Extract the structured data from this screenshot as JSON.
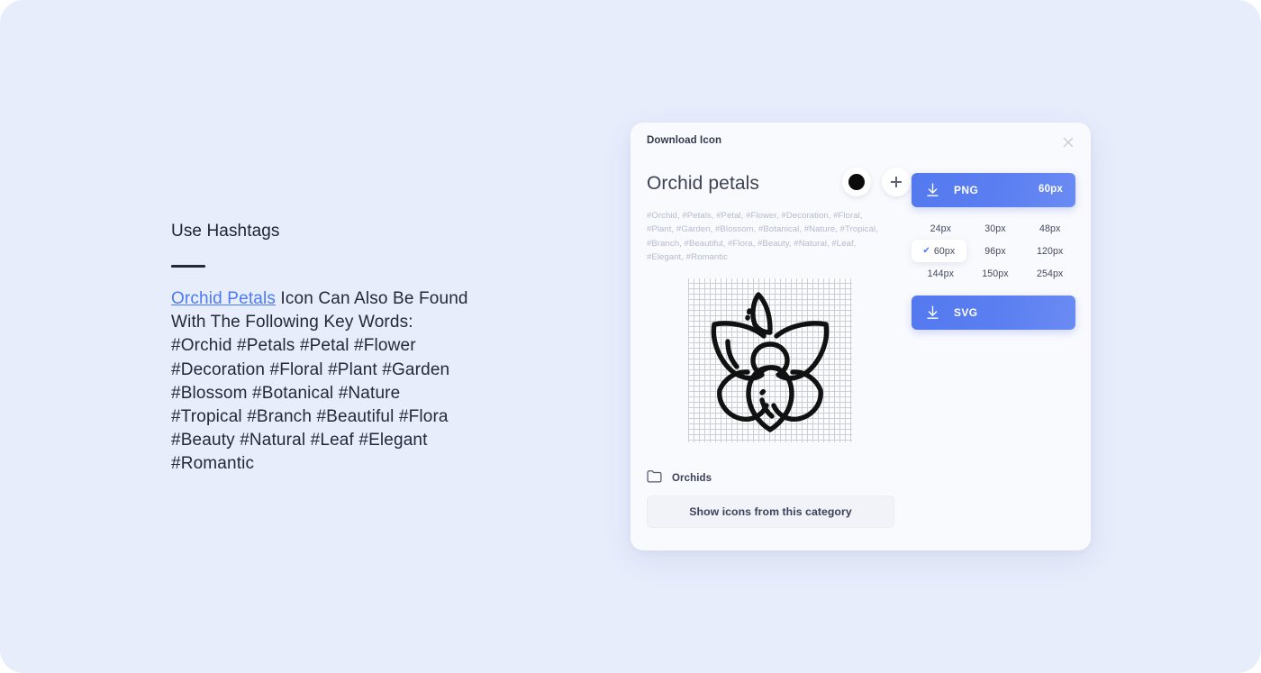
{
  "page": {
    "background_color": "#e8edfc"
  },
  "left_panel": {
    "heading": "Use Hashtags",
    "link_text": "Orchid Petals",
    "body_text": " Icon Can Also Be Found With The Following Key Words: #Orchid #Petals #Petal #Flower #Decoration #Floral #Plant #Garden #Blossom #Botanical #Nature #Tropical #Branch #Beautiful #Flora #Beauty #Natural #Leaf #Elegant #Romantic",
    "link_color": "#4b7bf5"
  },
  "modal": {
    "title": "Download Icon",
    "close_icon": "close-icon",
    "icon_name": "Orchid petals",
    "color_swatch": "#0b0b0b",
    "add_button_icon": "plus-icon",
    "tags": "#Orchid, #Petals, #Petal, #Flower, #Decoration, #Floral, #Plant, #Garden, #Blossom, #Botanical, #Nature, #Tropical, #Branch, #Beautiful, #Flora, #Beauty, #Natural, #Leaf, #Elegant, #Romantic",
    "preview_icon": "orchid-flower-icon",
    "folder": {
      "icon": "folder-icon",
      "label": "Orchids"
    },
    "category_button_label": "Show icons from this category",
    "download": {
      "png": {
        "icon": "download-icon",
        "format_label": "PNG",
        "size_label": "60px",
        "accent_color": "#5b7ff1"
      },
      "svg": {
        "icon": "download-icon",
        "format_label": "SVG",
        "accent_color": "#5b7ff1"
      },
      "sizes": [
        {
          "label": "24px",
          "selected": false
        },
        {
          "label": "30px",
          "selected": false
        },
        {
          "label": "48px",
          "selected": false
        },
        {
          "label": "60px",
          "selected": true
        },
        {
          "label": "96px",
          "selected": false
        },
        {
          "label": "120px",
          "selected": false
        },
        {
          "label": "144px",
          "selected": false
        },
        {
          "label": "150px",
          "selected": false
        },
        {
          "label": "254px",
          "selected": false
        }
      ],
      "check_glyph": "✔"
    }
  }
}
